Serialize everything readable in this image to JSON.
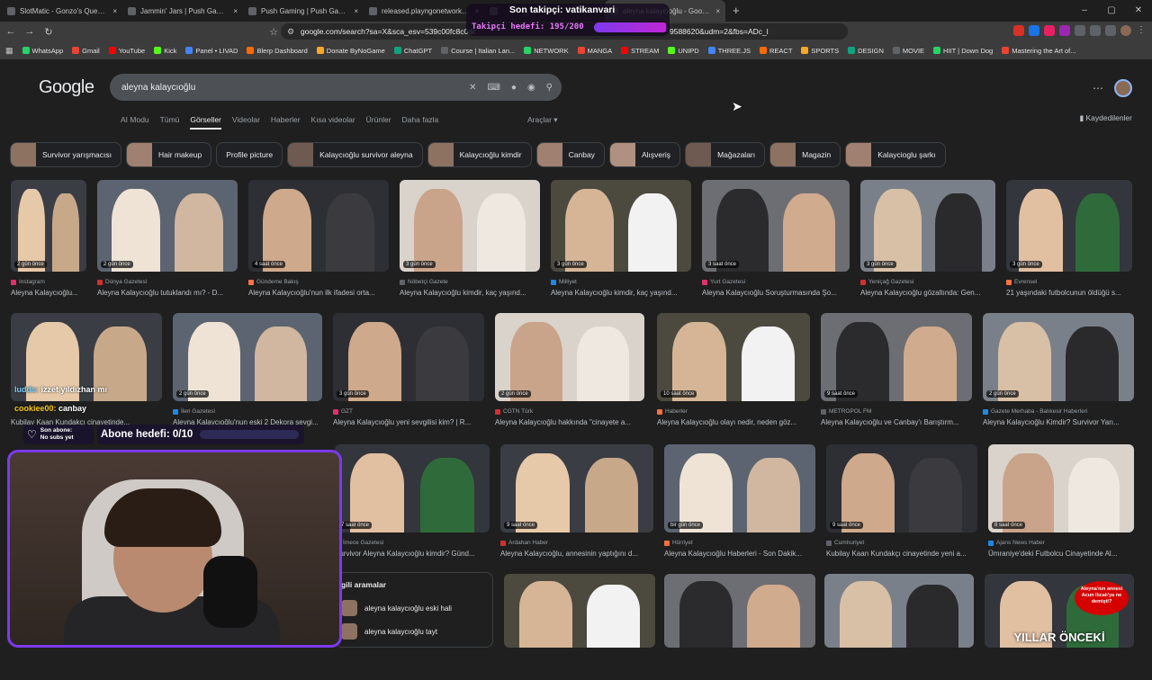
{
  "browser": {
    "tabs": [
      {
        "label": "SlotMatic - Gonzo's Quest Cascade |",
        "active": false
      },
      {
        "label": "Jammin' Jars | Push Gaming",
        "active": false
      },
      {
        "label": "Push Gaming | Push Gaming",
        "active": false
      },
      {
        "label": "released.playngonetwork.com/casin",
        "active": false
      },
      {
        "label": "",
        "active": false
      },
      {
        "label": "aleyna kalaycıoğlu - Google'da A",
        "active": true
      }
    ],
    "url": "google.com/search?sa=X&sca_esv=539c00fc8c0dc",
    "url_tail": "9588620&udm=2&fbs=ADc_l",
    "bookmarks": [
      "WhatsApp",
      "Gmail",
      "YouTube",
      "Kick",
      "Panel • LIVAD",
      "Blerp Dashboard",
      "Donate ByNoGame",
      "ChatGPT",
      "Course | Italian Lan...",
      "NETWORK",
      "MANGA",
      "STREAM",
      "UNIPD",
      "THREE.JS",
      "REACT",
      "SPORTS",
      "DESIGN",
      "MOVIE",
      "HIIT | Down Dog",
      "Mastering the Art of..."
    ]
  },
  "google": {
    "logo": "Google",
    "query": "aleyna kalaycıoğlu",
    "filters": [
      "AI Modu",
      "Tümü",
      "Görseller",
      "Videolar",
      "Haberler",
      "Kısa videolar",
      "Ürünler",
      "Daha fazla"
    ],
    "active_filter_index": 2,
    "tools": "Araçlar",
    "saved": "Kaydedilenler",
    "chips": [
      "Survivor yarışmacısı",
      "Hair makeup",
      "Profile picture",
      "Kalaycıoğlu survivor aleyna",
      "Kalaycıoğlu kimdir",
      "Canbay",
      "Alışveriş",
      "Mağazaları",
      "Magazin",
      "Kalaycioglu şarkı"
    ],
    "chips_without_thumb": [
      2
    ],
    "related": {
      "title": "gili aramalar",
      "items": [
        "aleyna kalaycıoğlu eski hali",
        "aleyna kalaycıoğlu tayt"
      ]
    },
    "results": [
      {
        "badge": "2 gün önce",
        "source": "Instagram",
        "title": "Aleyna Kalaycıoğlu..."
      },
      {
        "badge": "2 gün önce",
        "source": "Dünya Gazetesi",
        "title": "Aleyna Kalaycıoğlu tutuklandı mı? - D..."
      },
      {
        "badge": "4 saat önce",
        "source": "Gündeme Bakış",
        "title": "Aleyna Kalaycıoğlu'nun ilk ifadesi orta..."
      },
      {
        "badge": "3 gün önce",
        "source": "Nöbetçi Gazete",
        "title": "Aleyna Kalaycıoğlu kimdir, kaç yaşınd..."
      },
      {
        "badge": "3 gün önce",
        "source": "Milliyet",
        "title": "Aleyna Kalaycıoğlu kimdir, kaç yaşınd..."
      },
      {
        "badge": "3 saat önce",
        "source": "Yurt Gazetesi",
        "title": "Aleyna Kalaycıoğlu Soruşturmasında Şo..."
      },
      {
        "badge": "3 gün önce",
        "source": "Yeniçağ Gazetesi",
        "title": "Aleyna Kalaycıoğlu gözaltında: Gen..."
      },
      {
        "badge": "3 gün önce",
        "source": "Evrensel",
        "title": "21 yaşındaki futbolcunun öldüğü s..."
      },
      {
        "badge": "",
        "source": "",
        "title": "Kubilay Kaan Kundakçı cinayetinde..."
      },
      {
        "badge": "2 gün önce",
        "source": "İleri Gazetesi",
        "title": "Aleyna Kalaycıoğlu'nun eski 2 Dekora sevgi..."
      },
      {
        "badge": "3 gün önce",
        "source": "GZT",
        "title": "Aleyna Kalaycıoğlu yeni sevgilisi kim? | R..."
      },
      {
        "badge": "2 gün önce",
        "source": "CGTN Türk",
        "title": "Aleyna Kalaycıoğlu hakkında \"cinayete a..."
      },
      {
        "badge": "10 saat önce",
        "source": "Haberler",
        "title": "Aleyna Kalaycıoğlu olayı nedir, neden göz..."
      },
      {
        "badge": "9 saat önce",
        "source": "METROPOL FM",
        "title": "Aleyna Kalaycıoğlu ve Canbay'ı Barıştırm..."
      },
      {
        "badge": "2 gün önce",
        "source": "Gazete Merhaba - Balıkesir Haberleri",
        "title": "Aleyna Kalaycıoğlu Kimdir? Survivor Yarı..."
      },
      {
        "badge": "7 saat önce",
        "source": "İmece Gazetesi",
        "title": "Survivor Aleyna Kalaycıoğlu kimdir? Günd..."
      },
      {
        "badge": "9 saat önce",
        "source": "Ardahan Haber",
        "title": "Aleyna Kalaycıoğlu, annesinin yaptığını d..."
      },
      {
        "badge": "bir gün önce",
        "source": "Hürriyet",
        "title": "Aleyna Kalaycıoğlu Haberleri - Son Dakik..."
      },
      {
        "badge": "9 saat önce",
        "source": "Cumhuriyet",
        "title": "Kubilay Kaan Kundakçı cinayetinde yeni a..."
      },
      {
        "badge": "8 saat önce",
        "source": "Ajans News Haber",
        "title": "Ümraniye'deki Futbolcu Cinayetinde Al..."
      },
      {
        "badge": "",
        "source": "",
        "title": ""
      },
      {
        "badge": "",
        "source": "",
        "title": ""
      },
      {
        "badge": "",
        "source": "",
        "title": ""
      },
      {
        "badge": "",
        "source": "",
        "title": ""
      }
    ],
    "last_thumb_text": "YILLAR ÖNCEKİ",
    "last_thumb_bubble": "Aleyna'nın annesi Acun Ilıcalı'ya ne demişti?"
  },
  "stream_overlay": {
    "follower_goal_title": "Son takipçi: vatikanvari",
    "follower_goal_text": "Takipçi hedefi: 195/200",
    "follower_goal_progress": 0.975,
    "last_sub_label": "Son abone:",
    "last_sub_value": "No subs yet",
    "sub_goal_text": "Abone hedefi: 0/10",
    "sub_goal_progress": 0,
    "chat": [
      {
        "user": "ludds:",
        "message": " izzet yıldızhan mı"
      },
      {
        "user": "cookiee00:",
        "message": " canbay"
      }
    ]
  },
  "colors": {
    "accent": "#7c3aed",
    "page_bg": "#1f1f1f",
    "tab_bg": "#3c3c3c"
  }
}
